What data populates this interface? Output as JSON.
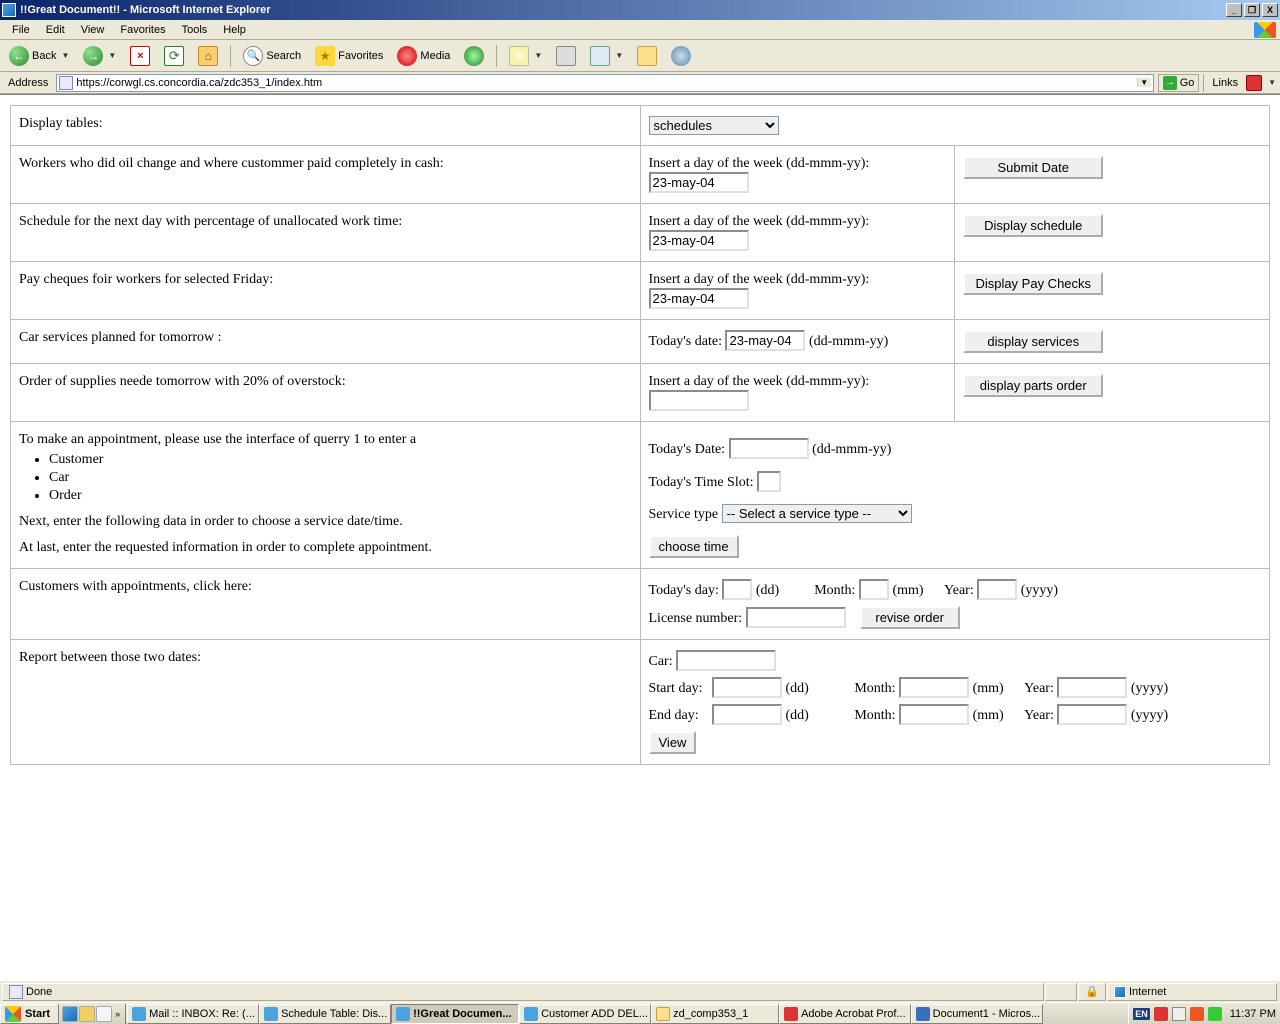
{
  "titlebar": {
    "title": "!!Great Document!! - Microsoft Internet Explorer"
  },
  "menubar": {
    "file": "File",
    "edit": "Edit",
    "view": "View",
    "favorites": "Favorites",
    "tools": "Tools",
    "help": "Help"
  },
  "toolbar": {
    "back": "Back",
    "search": "Search",
    "favorites": "Favorites",
    "media": "Media"
  },
  "addressbar": {
    "label": "Address",
    "url": "https://corwgl.cs.concordia.ca/zdc353_1/index.htm",
    "go": "Go",
    "links": "Links"
  },
  "page": {
    "row1": {
      "label": "Display tables:",
      "select": "schedules"
    },
    "row2": {
      "label": "Workers who did oil change and where custommer paid completely in cash:",
      "hint": "Insert a day of the week (dd-mmm-yy):",
      "val": "23-may-04",
      "btn": "Submit Date"
    },
    "row3": {
      "label": "Schedule for the next day with percentage of unallocated work time:",
      "hint": "Insert a day of the week (dd-mmm-yy):",
      "val": "23-may-04",
      "btn": "Display schedule"
    },
    "row4": {
      "label": "Pay cheques foir workers for selected Friday:",
      "hint": "Insert a day of the week (dd-mmm-yy):",
      "val": "23-may-04",
      "btn": "Display Pay Checks"
    },
    "row5": {
      "label": "Car services planned for tomorrow :",
      "hint": "Today's date:",
      "val": "23-may-04",
      "suffix": "(dd-mmm-yy)",
      "btn": "display services"
    },
    "row6": {
      "label": "Order of supplies neede tomorrow with 20% of overstock:",
      "hint": "Insert a day of the week (dd-mmm-yy):",
      "val": "",
      "btn": "display parts order"
    },
    "row7": {
      "intro": "To make an appointment, please use the interface of querry 1 to enter a",
      "li1": "Customer",
      "li2": "Car",
      "li3": "Order",
      "p2": "Next, enter the following data in order to choose a service date/time.",
      "p3": "At last, enter the requested information in order to complete appointment.",
      "date_lbl": "Today's Date:",
      "date_sfx": "(dd-mmm-yy)",
      "slot_lbl": "Today's Time Slot:",
      "svc_lbl": "Service type",
      "svc_sel": "-- Select a service type --",
      "btn": "choose time"
    },
    "row8": {
      "label": "Customers with appointments, click here:",
      "day_lbl": "Today's day:",
      "day_sfx": "(dd)",
      "mon_lbl": "Month:",
      "mon_sfx": "(mm)",
      "yr_lbl": "Year:",
      "yr_sfx": "(yyyy)",
      "lic_lbl": "License number:",
      "btn": "revise order"
    },
    "row9": {
      "label": "Report between those two dates:",
      "car_lbl": "Car:",
      "start_lbl": "Start day:",
      "end_lbl": "End day:",
      "dd": "(dd)",
      "mon_lbl": "Month:",
      "mm": "(mm)",
      "yr_lbl": "Year:",
      "yy": "(yyyy)",
      "btn": "View"
    }
  },
  "statusbar": {
    "done": "Done",
    "zone": "Internet"
  },
  "taskbar": {
    "start": "Start",
    "t1": "Mail :: INBOX: Re: (...",
    "t2": "Schedule Table: Dis...",
    "t3": "!!Great Documen...",
    "t4": "Customer ADD DEL...",
    "t5": "zd_comp353_1",
    "t6": "Adobe Acrobat Prof...",
    "t7": "Document1 - Micros...",
    "lang": "EN",
    "clock": "11:37 PM"
  }
}
